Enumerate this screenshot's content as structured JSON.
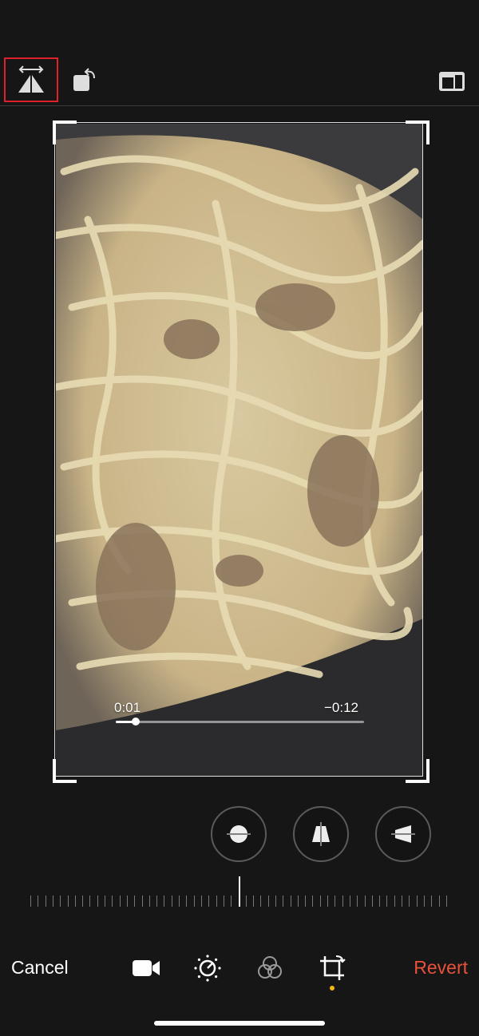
{
  "toolbar_top": {
    "flip_icon": "flip-horizontal-icon",
    "rotate_icon": "rotate-icon",
    "aspect_icon": "aspect-ratio-icon"
  },
  "video": {
    "time_elapsed": "0:01",
    "time_remaining": "−0:12",
    "progress": 0.08
  },
  "adjustments": {
    "straighten_icon": "straighten-icon",
    "vertical_icon": "vertical-perspective-icon",
    "horizontal_icon": "horizontal-perspective-icon"
  },
  "bottom_bar": {
    "cancel_label": "Cancel",
    "revert_label": "Revert",
    "tools": [
      "video-icon",
      "adjust-icon",
      "filters-icon",
      "crop-icon"
    ],
    "active_tool": "crop-icon"
  },
  "colors": {
    "background": "#161616",
    "revert": "#e8523a",
    "highlight": "#e0202a",
    "active_dot": "#f5b90a"
  }
}
